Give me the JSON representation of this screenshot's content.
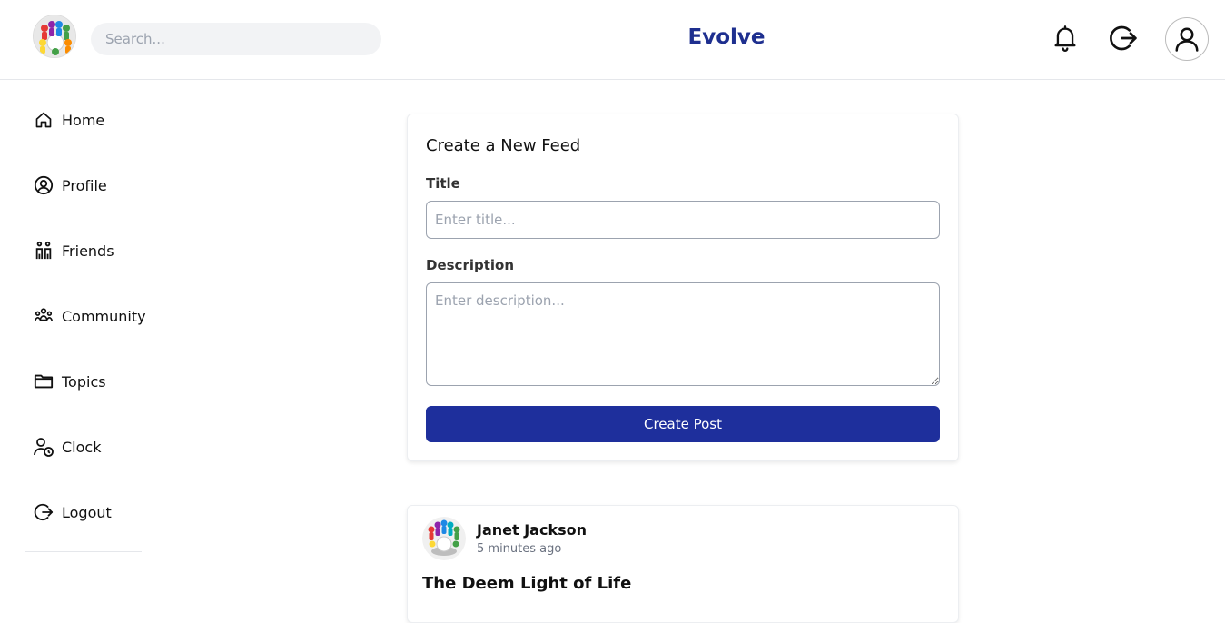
{
  "header": {
    "app_title": "Evolve",
    "search_placeholder": "Search...",
    "icons": [
      "bell-icon",
      "logout-icon",
      "user-avatar-icon"
    ]
  },
  "sidebar": {
    "items": [
      {
        "label": "Home",
        "icon": "home-icon"
      },
      {
        "label": "Profile",
        "icon": "profile-icon"
      },
      {
        "label": "Friends",
        "icon": "friends-icon"
      },
      {
        "label": "Community",
        "icon": "community-icon"
      },
      {
        "label": "Topics",
        "icon": "folder-icon"
      },
      {
        "label": "Clock",
        "icon": "user-clock-icon"
      },
      {
        "label": "Logout",
        "icon": "logout-icon"
      }
    ]
  },
  "create_feed": {
    "heading": "Create a New Feed",
    "title_label": "Title",
    "title_placeholder": "Enter title...",
    "description_label": "Description",
    "description_placeholder": "Enter description...",
    "submit_label": "Create Post"
  },
  "post": {
    "author": "Janet Jackson",
    "time": "5 minutes ago",
    "title": "The Deem Light of Life"
  },
  "colors": {
    "brand": "#1e2f8f",
    "button": "#1e2f9c"
  }
}
